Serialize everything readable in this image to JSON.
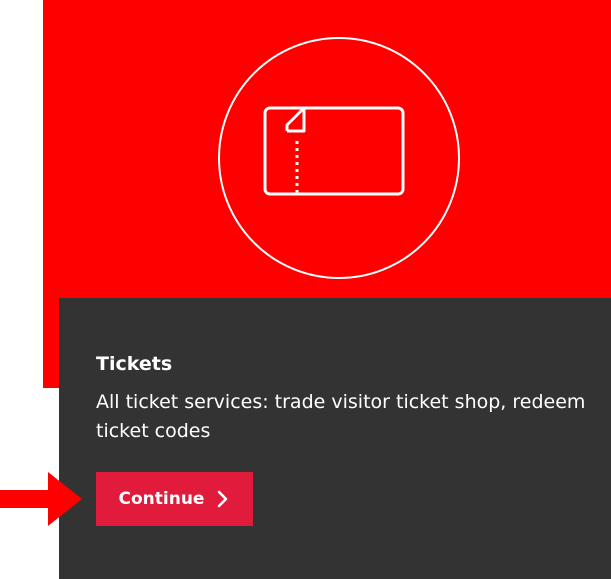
{
  "card": {
    "title": "Tickets",
    "description": "All ticket services: trade visitor ticket shop, redeem ticket codes",
    "button_label": "Continue",
    "button_icon": "chevron-right-icon"
  },
  "icons": {
    "hero_icon": "ticket-icon",
    "annotation_marker": "arrow-right-icon"
  },
  "colors": {
    "hero_background": "#ff0000",
    "card_background": "#333333",
    "button_background": "#e11b3c",
    "annotation_arrow": "#ff0000",
    "text": "#ffffff"
  }
}
